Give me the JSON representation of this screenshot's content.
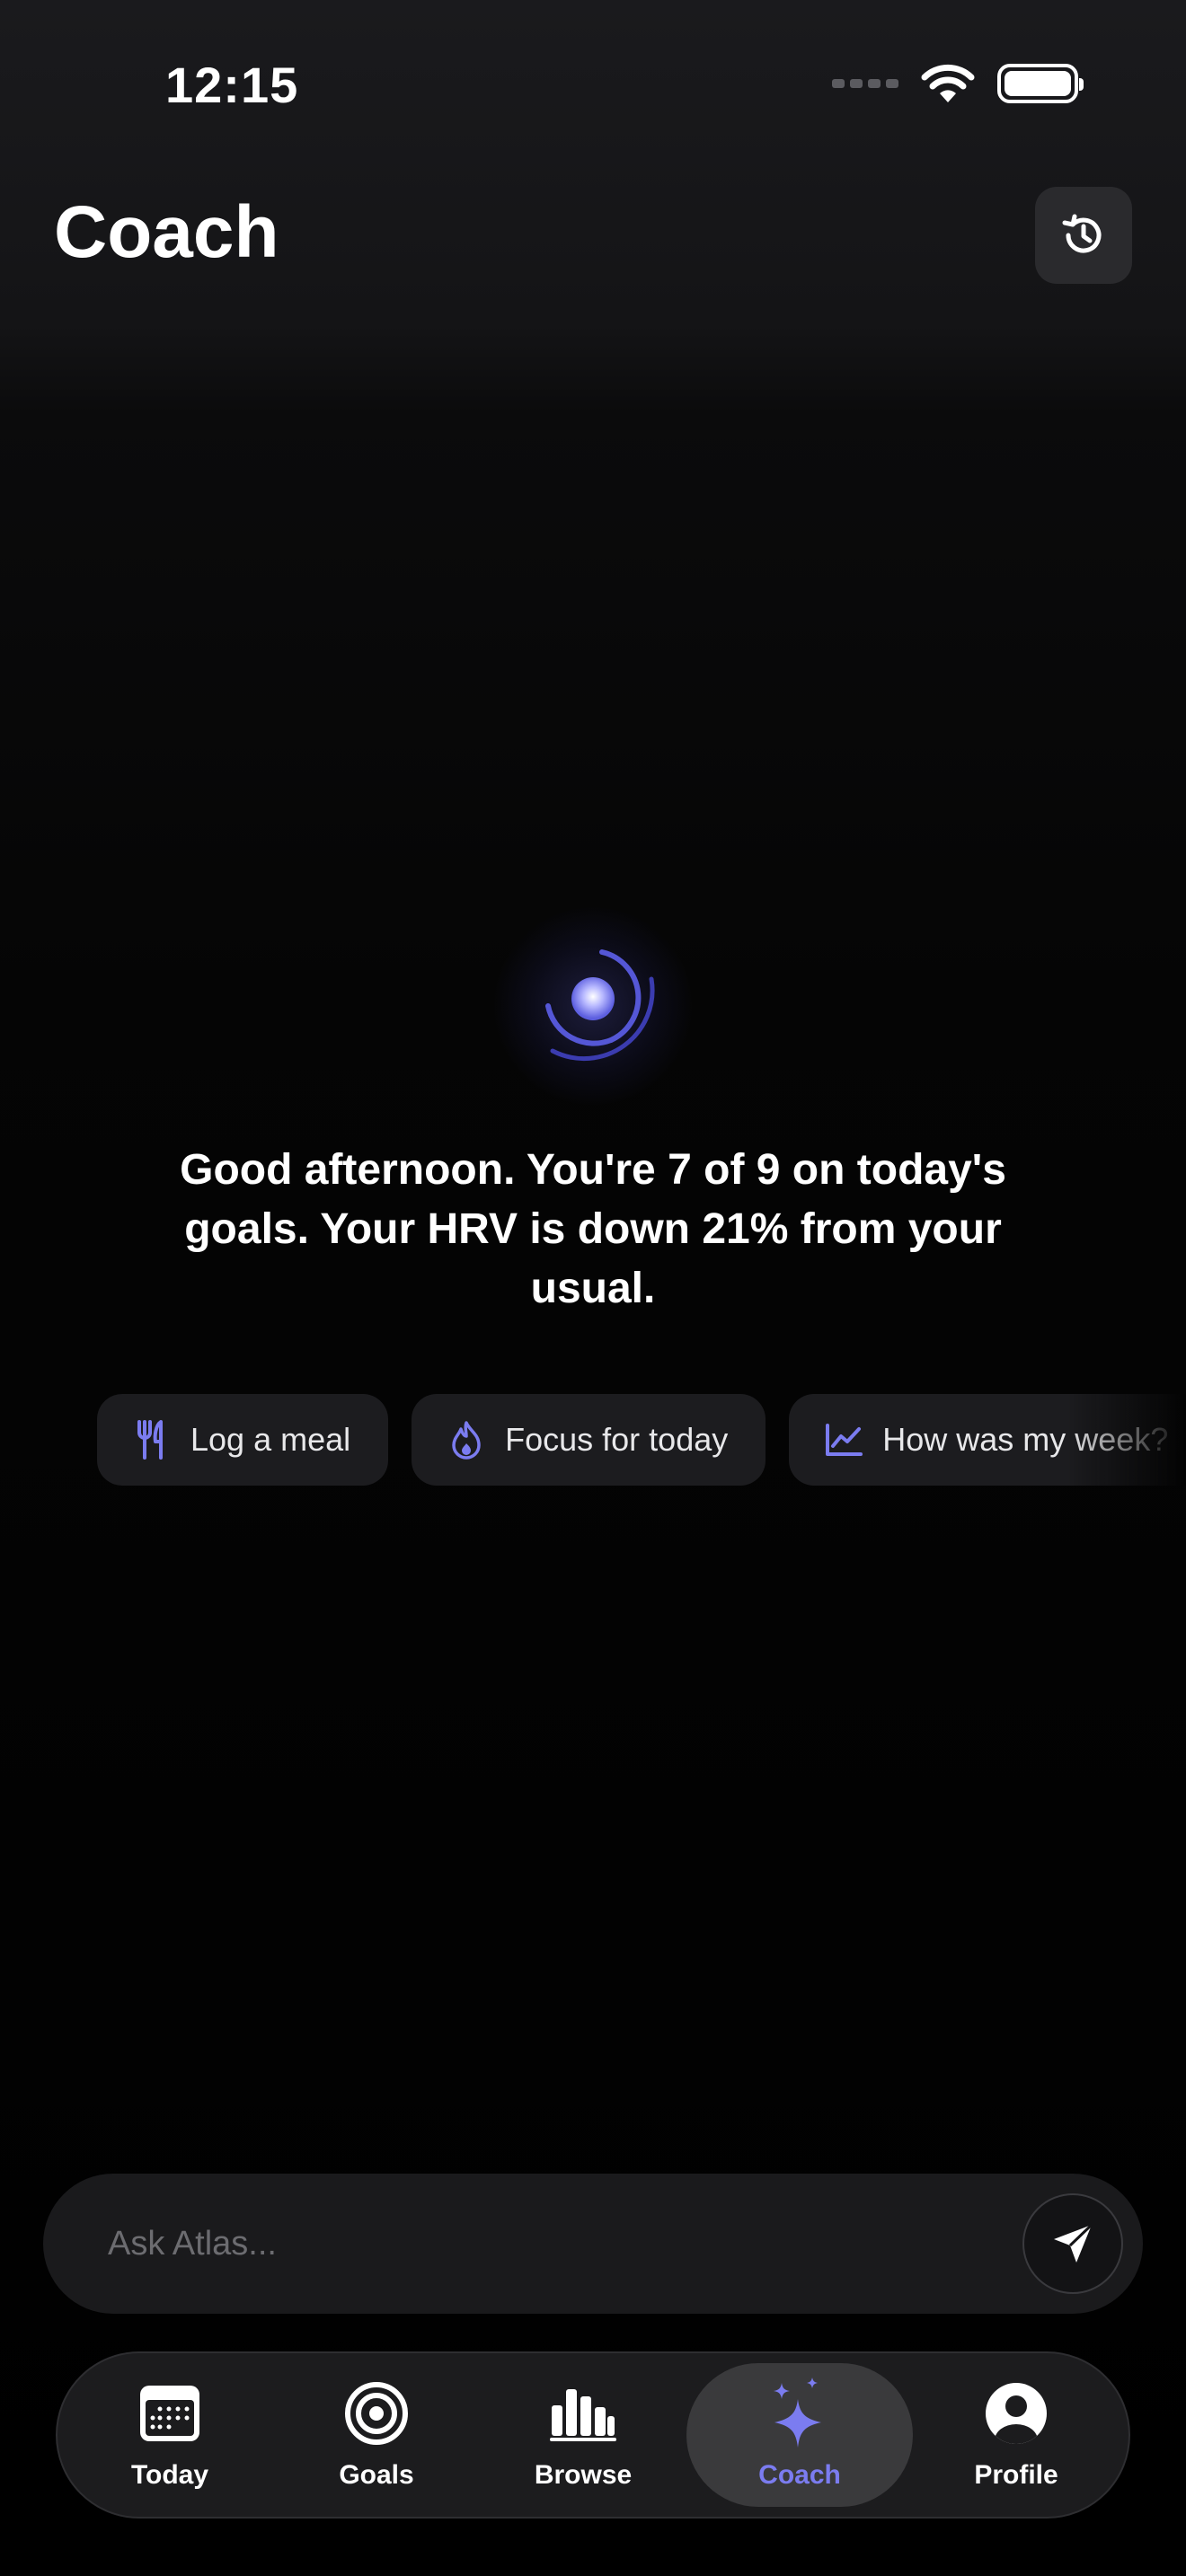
{
  "status_bar": {
    "time": "12:15"
  },
  "header": {
    "title": "Coach",
    "history_icon": "history-icon"
  },
  "greeting": {
    "text": "Good afternoon. You're 7 of 9 on today's goals. Your HRV is down 21% from your usual."
  },
  "chips": [
    {
      "label": "Log a meal",
      "icon": "fork-knife-icon"
    },
    {
      "label": "Focus for today",
      "icon": "flame-icon"
    },
    {
      "label": "How was my week?",
      "icon": "trend-chart-icon"
    }
  ],
  "input": {
    "placeholder": "Ask Atlas...",
    "value": ""
  },
  "tabs": [
    {
      "label": "Today",
      "icon": "calendar-icon",
      "active": false
    },
    {
      "label": "Goals",
      "icon": "target-icon",
      "active": false
    },
    {
      "label": "Browse",
      "icon": "bar-chart-icon",
      "active": false
    },
    {
      "label": "Coach",
      "icon": "sparkle-icon",
      "active": true
    },
    {
      "label": "Profile",
      "icon": "person-icon",
      "active": false
    }
  ],
  "colors": {
    "accent": "#7b7cf0",
    "background": "#000000",
    "header_background": "#1a1a1d",
    "chip_background": "#1c1c1f",
    "tab_active_background": "#3a3a3c"
  }
}
